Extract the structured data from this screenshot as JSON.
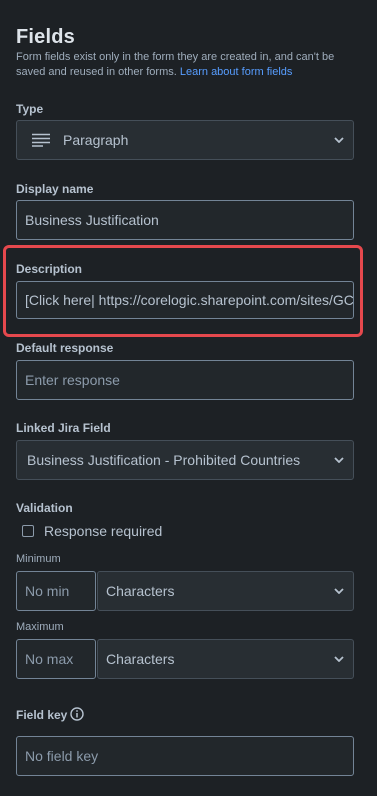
{
  "panel": {
    "title": "Fields",
    "subtitle": "Form fields exist only in the form they are created in, and can't be saved and reused in other forms.",
    "learn_link": "Learn about form fields"
  },
  "type_field": {
    "label": "Type",
    "value": "Paragraph",
    "icon": "paragraph-lines-icon"
  },
  "display_name": {
    "label": "Display name",
    "value": "Business Justification"
  },
  "description": {
    "label": "Description",
    "value": "[Click here| https://corelogic.sharepoint.com/sites/GC"
  },
  "default_response": {
    "label": "Default response",
    "placeholder": "Enter response"
  },
  "linked_jira": {
    "label": "Linked Jira Field",
    "value": "Business Justification - Prohibited Countries"
  },
  "validation": {
    "label": "Validation",
    "response_required": "Response required",
    "minimum_label": "Minimum",
    "minimum_placeholder": "No min",
    "minimum_unit": "Characters",
    "maximum_label": "Maximum",
    "maximum_placeholder": "No max",
    "maximum_unit": "Characters"
  },
  "field_key": {
    "label": "Field key",
    "placeholder": "No field key",
    "icon": "info-icon"
  },
  "colors": {
    "background": "#1d2125",
    "highlight": "#e5484d",
    "link": "#579dff"
  }
}
